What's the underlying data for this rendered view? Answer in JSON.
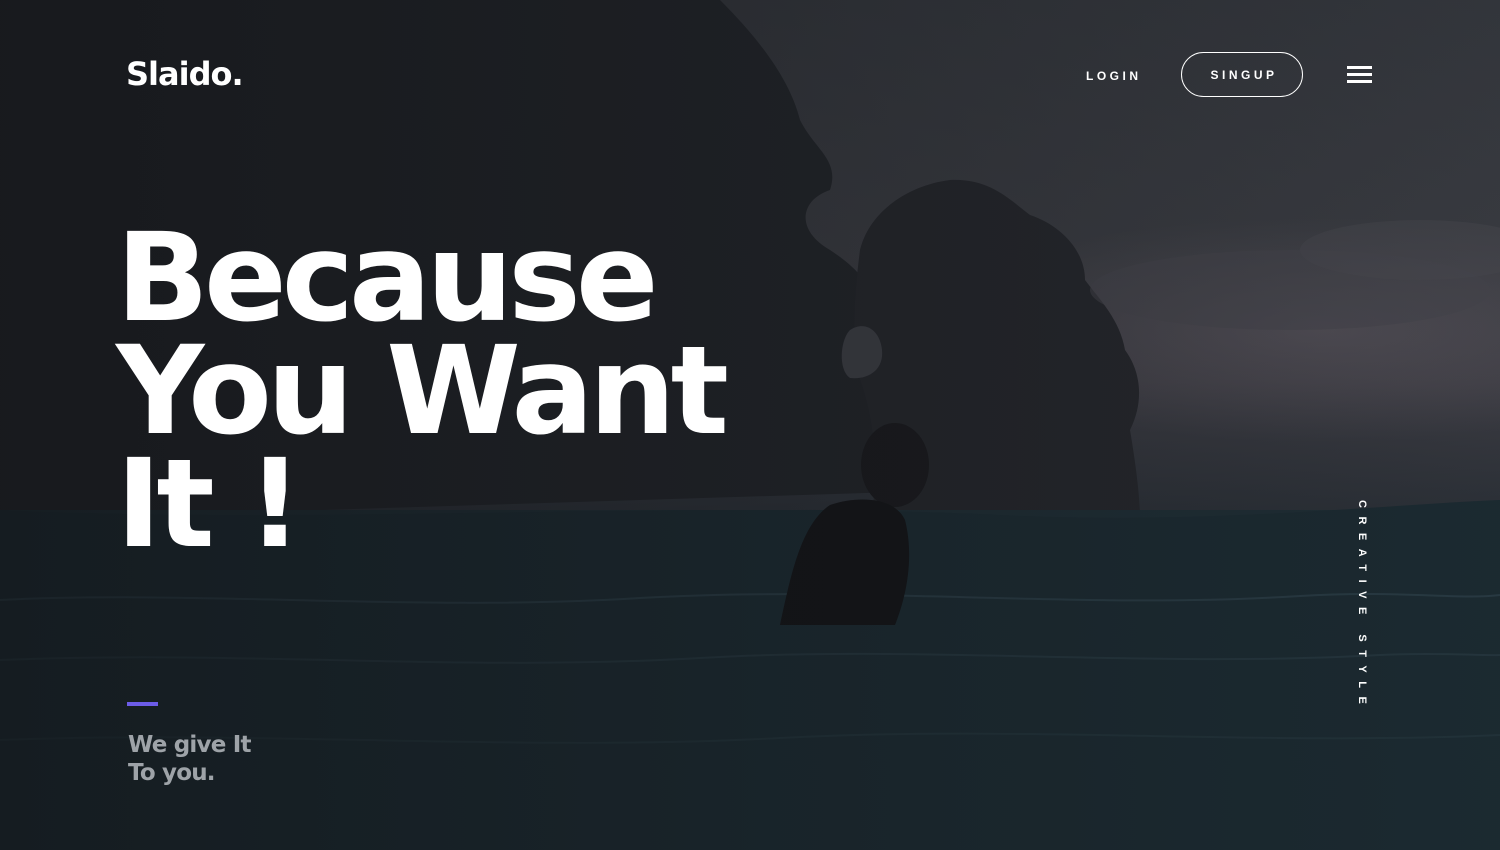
{
  "brand": {
    "name": "Slaido."
  },
  "nav": {
    "login_label": "LOGIN",
    "signup_label": "SINGUP",
    "menu_icon": "hamburger-menu-icon"
  },
  "hero": {
    "headline_lines": [
      "Because",
      "You Want",
      "It !"
    ],
    "tagline_lines": [
      "We give It",
      "To you."
    ],
    "side_label": "CREATIVE STYLE"
  },
  "colors": {
    "accent": "#6c5ce7",
    "text": "#ffffff",
    "tagline": "#9ea3a8",
    "background": "#2b2f35"
  }
}
